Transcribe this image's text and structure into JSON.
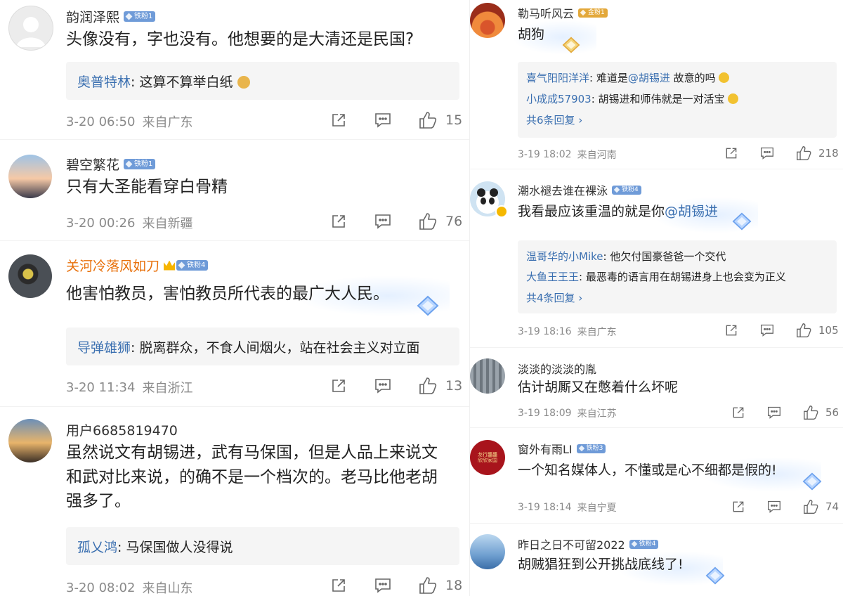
{
  "left": {
    "comments": [
      {
        "name": "韵润泽熙",
        "badge": "铁粉1",
        "text": "头像没有，字也没有。他想要的是大清还是民国?",
        "replies": [
          {
            "user": "奥普特林",
            "text": ": 这算不算举白纸"
          }
        ],
        "date": "3-20 06:50",
        "location": "来自广东",
        "likes": "15"
      },
      {
        "name": "碧空繁花",
        "badge": "铁粉1",
        "text": "只有大圣能看穿白骨精",
        "date": "3-20 00:26",
        "location": "来自新疆",
        "likes": "76"
      },
      {
        "name": "关河冷落风如刀",
        "badge": "铁粉4",
        "text": "他害怕教员，害怕教员所代表的最广大人民。",
        "replies": [
          {
            "user": "导弹雄狮",
            "text": ": 脱离群众，不食人间烟火，站在社会主义对立面"
          }
        ],
        "date": "3-20 11:34",
        "location": "来自浙江",
        "likes": "13"
      },
      {
        "name": "用户6685819470",
        "text_lines": [
          "虽然说文有胡锡进，武有马保国，但是人品上来说文",
          "和武对比来说，的确不是一个档次的。老马比他老胡",
          "强多了。"
        ],
        "replies": [
          {
            "user": "孤乂鸿",
            "text": ": 马保国做人没得说"
          }
        ],
        "date": "3-20 08:02",
        "location": "来自山东",
        "likes": "18"
      }
    ]
  },
  "right": {
    "comments": [
      {
        "name": "勒马听风云",
        "badge": "金粉1",
        "text": "胡狗",
        "replies": [
          {
            "user": "喜气阳阳洋洋",
            "text": ": 难道是",
            "mention": "@胡锡进",
            "tail": " 故意的吗"
          },
          {
            "user": "小成成57903",
            "text": ": 胡锡进和师伟就是一对活宝"
          }
        ],
        "more": "共6条回复 ›",
        "date": "3-19 18:02",
        "location": "来自河南",
        "likes": "218"
      },
      {
        "name": "潮水褪去谁在裸泳",
        "badge": "铁粉4",
        "text": "我看最应该重温的就是你",
        "mention": "@胡锡进",
        "replies": [
          {
            "user": "温哥华的小Mike",
            "text": ": 他欠付国豪爸爸一个交代"
          },
          {
            "user": "大鱼王王王",
            "text": ": 最恶毒的语言用在胡锡进身上也会变为正义"
          }
        ],
        "more": "共4条回复 ›",
        "date": "3-19 18:16",
        "location": "来自广东",
        "likes": "105"
      },
      {
        "name": "淡淡的淡淡的胤",
        "text": "估计胡厮又在憋着什么坏呢",
        "date": "3-19 18:09",
        "location": "来自江苏",
        "likes": "56"
      },
      {
        "name": "窗外有雨LI",
        "badge": "铁粉3",
        "text": "一个知名媒体人，不懂或是心不细都是假的!",
        "date": "3-19 18:14",
        "location": "来自宁夏",
        "likes": "74"
      },
      {
        "name": "昨日之日不可留2022",
        "badge": "铁粉4",
        "text": "胡贼猖狂到公开挑战底线了!",
        "avatar_text": "",
        "date": "",
        "location": "",
        "likes": ""
      }
    ],
    "avatar4_text": "龙行龘龘 欣欣家国"
  },
  "colors": {
    "name_orange": "#e8700a",
    "blue_link": "#3a6fb0",
    "badge_blue": "#6f9bd8",
    "badge_gold": "#e3a83a",
    "meta_gray": "#8a8a8a"
  }
}
